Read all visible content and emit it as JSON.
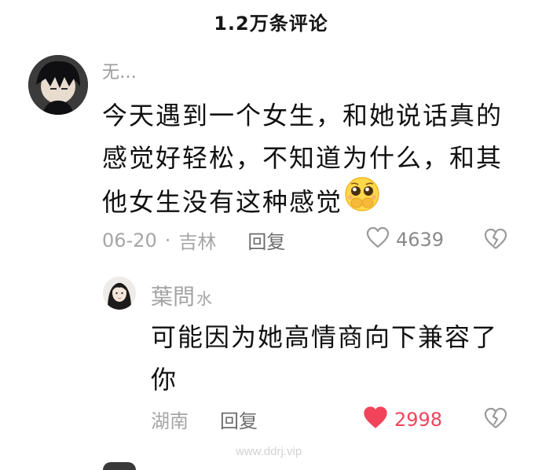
{
  "header": {
    "title": "1.2万条评论"
  },
  "comment": {
    "username": "无…",
    "text": "今天遇到一个女生，和她说话真的感觉好轻松，不知道为什么，和其他女生没有这种感觉",
    "emoji": "pleading-hands-over-mouth-emoji",
    "date": "06-20",
    "separator": "·",
    "location": "吉林",
    "reply_label": "回复",
    "likes": "4639",
    "liked": false
  },
  "reply": {
    "username": "葉問",
    "username_suffix": "水",
    "text": "可能因为她高情商向下兼容了你",
    "location": "湖南",
    "reply_label": "回复",
    "likes": "2998",
    "liked": true
  },
  "watermark": "www.ddrj.vip",
  "colors": {
    "liked_heart": "#f1445b",
    "meta_gray": "#a6a6a6",
    "text_dark": "#111111"
  }
}
